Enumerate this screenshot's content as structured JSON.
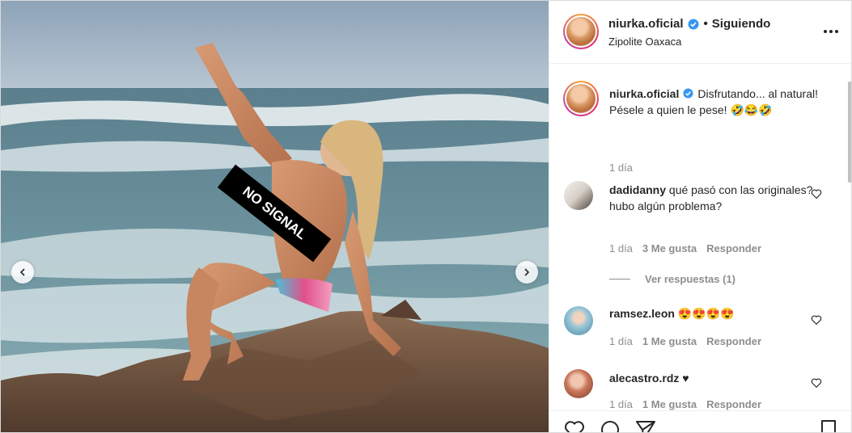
{
  "post": {
    "username": "niurka.oficial",
    "follow_status": "Siguiendo",
    "separator": "•",
    "location": "Zipolite Oaxaca",
    "caption_line1": "Disfrutando... al natural!",
    "caption_line2": "Pésele a quien le pese! 🤣😂🤣",
    "caption_time": "1 día",
    "censor_label": "NO SIGNAL"
  },
  "comments": [
    {
      "username": "dadidanny",
      "text": "qué pasó con las originales? hubo algún problema?",
      "time": "1 día",
      "likes": "3 Me gusta",
      "reply": "Responder",
      "view_replies": "Ver respuestas (1)"
    },
    {
      "username": "ramsez.leon",
      "text": "😍😍😍😍",
      "time": "1 día",
      "likes": "1 Me gusta",
      "reply": "Responder"
    },
    {
      "username": "alecastro.rdz",
      "text": "♥",
      "time": "1 día",
      "likes": "1 Me gusta",
      "reply": "Responder"
    }
  ],
  "icons": {
    "verified": "verified-badge-icon",
    "more": "more-options-icon",
    "like": "heart-icon",
    "comment": "comment-icon",
    "share": "share-icon",
    "save": "bookmark-icon",
    "prev": "chevron-left-icon",
    "next": "chevron-right-icon"
  },
  "colors": {
    "verified_blue": "#3897f0",
    "text": "#262626",
    "muted": "#8e8e8e",
    "border": "#dbdbdb"
  }
}
